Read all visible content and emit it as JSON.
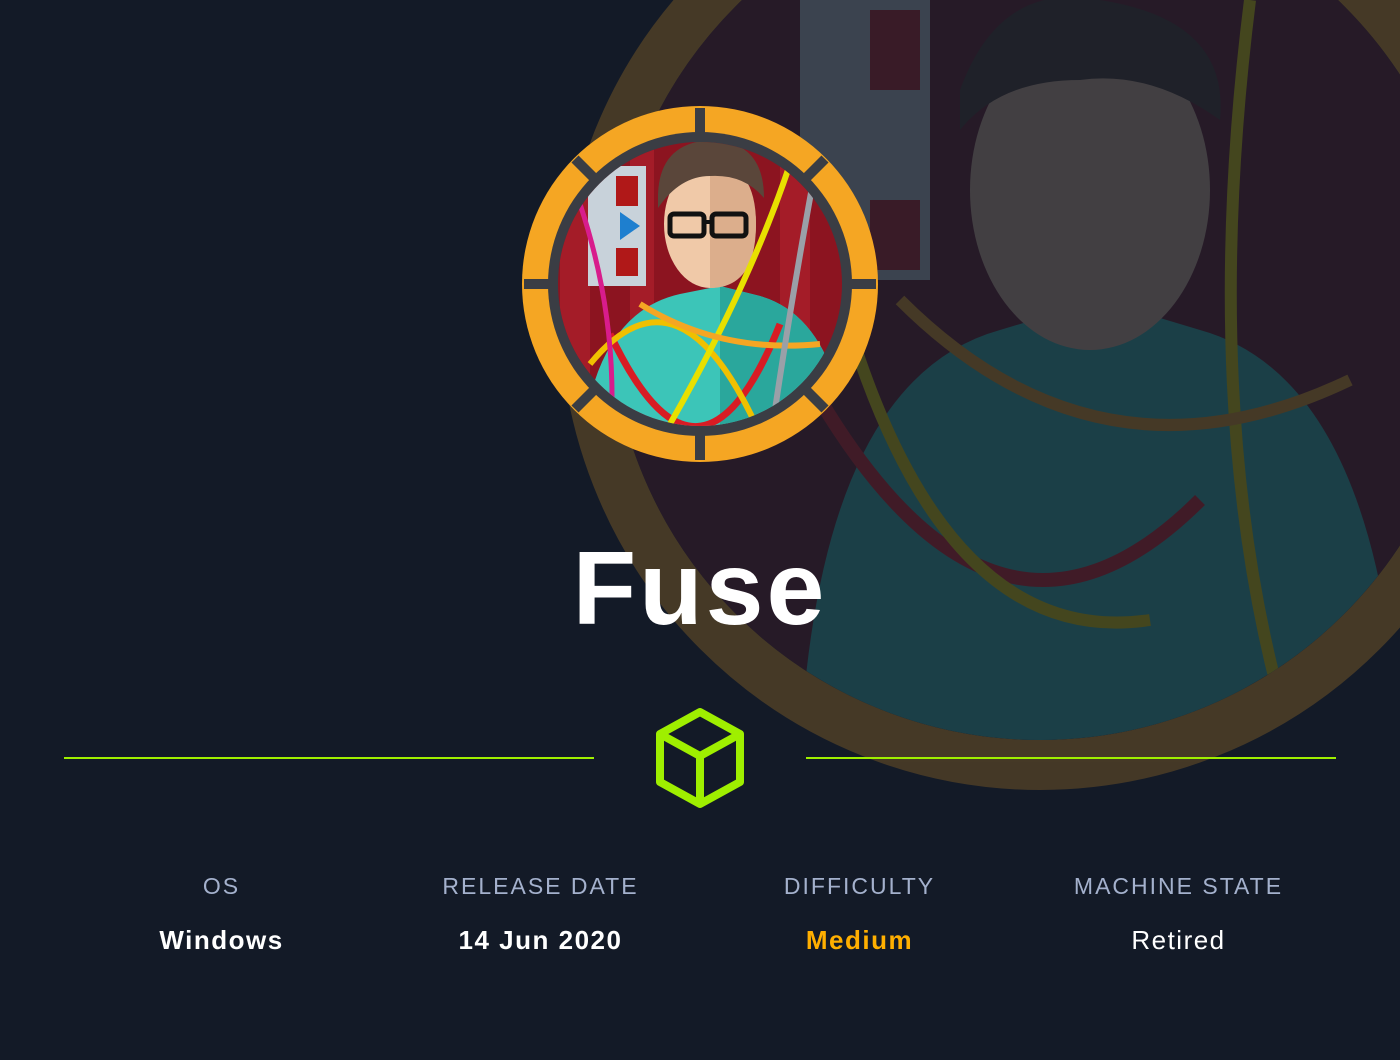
{
  "machine": {
    "name": "Fuse"
  },
  "stats": [
    {
      "label": "OS",
      "value": "Windows"
    },
    {
      "label": "RELEASE DATE",
      "value": "14 Jun 2020"
    },
    {
      "label": "DIFFICULTY",
      "value": "Medium"
    },
    {
      "label": "MACHINE STATE",
      "value": "Retired"
    }
  ],
  "colors": {
    "background": "#131a27",
    "accent": "#9fef00",
    "difficulty_medium": "#ffaf00",
    "label": "#a4b1cd",
    "badge_ring": "#f5a623"
  },
  "icons": {
    "logo": "hack-the-box-cube-icon",
    "avatar": "machine-avatar-fuse"
  }
}
